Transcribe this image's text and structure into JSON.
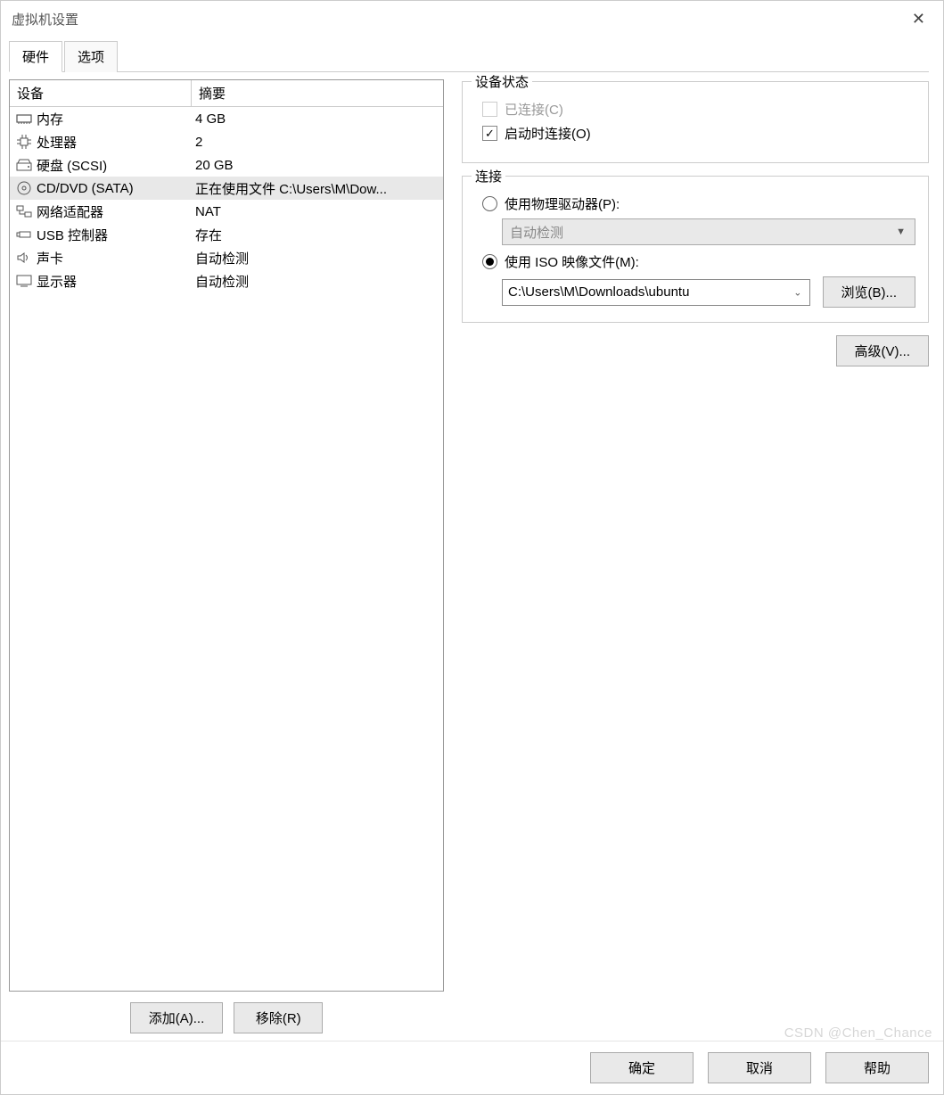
{
  "window": {
    "title": "虚拟机设置"
  },
  "tabs": [
    {
      "label": "硬件",
      "active": true
    },
    {
      "label": "选项",
      "active": false
    }
  ],
  "device_list": {
    "headers": {
      "device": "设备",
      "summary": "摘要"
    },
    "rows": [
      {
        "icon": "memory-icon",
        "device": "内存",
        "summary": "4 GB",
        "selected": false
      },
      {
        "icon": "cpu-icon",
        "device": "处理器",
        "summary": "2",
        "selected": false
      },
      {
        "icon": "disk-icon",
        "device": "硬盘 (SCSI)",
        "summary": "20 GB",
        "selected": false
      },
      {
        "icon": "cd-icon",
        "device": "CD/DVD (SATA)",
        "summary": "正在使用文件 C:\\Users\\M\\Dow...",
        "selected": true
      },
      {
        "icon": "network-icon",
        "device": "网络适配器",
        "summary": "NAT",
        "selected": false
      },
      {
        "icon": "usb-icon",
        "device": "USB 控制器",
        "summary": "存在",
        "selected": false
      },
      {
        "icon": "sound-icon",
        "device": "声卡",
        "summary": "自动检测",
        "selected": false
      },
      {
        "icon": "display-icon",
        "device": "显示器",
        "summary": "自动检测",
        "selected": false
      }
    ]
  },
  "left_buttons": {
    "add": "添加(A)...",
    "remove": "移除(R)"
  },
  "status_group": {
    "legend": "设备状态",
    "connected": {
      "label": "已连接(C)",
      "checked": false,
      "disabled": true
    },
    "connect_on_power": {
      "label": "启动时连接(O)",
      "checked": true
    }
  },
  "connection_group": {
    "legend": "连接",
    "use_physical": {
      "label": "使用物理驱动器(P):",
      "selected": false,
      "dropdown": "自动检测"
    },
    "use_iso": {
      "label": "使用 ISO 映像文件(M):",
      "selected": true,
      "path": "C:\\Users\\M\\Downloads\\ubuntu",
      "browse": "浏览(B)..."
    }
  },
  "advanced_button": "高级(V)...",
  "footer": {
    "ok": "确定",
    "cancel": "取消",
    "help": "帮助"
  },
  "watermark": "CSDN @Chen_Chance"
}
